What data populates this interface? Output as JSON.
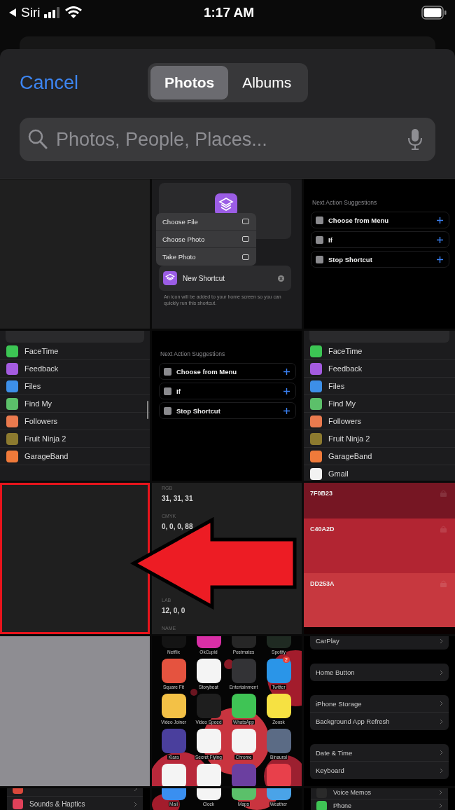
{
  "status_bar": {
    "back_label": "Siri",
    "time": "1:17 AM"
  },
  "header": {
    "cancel": "Cancel",
    "segments": [
      {
        "label": "Photos",
        "selected": true
      },
      {
        "label": "Albums",
        "selected": false
      }
    ],
    "search": {
      "placeholder": "Photos, People, Places..."
    }
  },
  "thumbnails": [
    {
      "kind": "blank",
      "highlighted": false
    },
    {
      "kind": "shortcut_menu",
      "highlighted": false,
      "menu": [
        "Choose File",
        "Choose Photo",
        "Take Photo"
      ],
      "name": "New Shortcut",
      "note": "An icon will be added to your home screen so you can quickly run this shortcut."
    },
    {
      "kind": "suggestions",
      "highlighted": false,
      "heading": "Next Action Suggestions",
      "actions": [
        "Choose from Menu",
        "If",
        "Stop Shortcut"
      ]
    },
    {
      "kind": "app_list",
      "highlighted": false,
      "scrollbar": true,
      "apps": [
        {
          "name": "FaceTime",
          "color": "#3cc654"
        },
        {
          "name": "Feedback",
          "color": "#a45be0"
        },
        {
          "name": "Files",
          "color": "#3d8fe8"
        },
        {
          "name": "Find My",
          "color": "#5cc06a"
        },
        {
          "name": "Followers",
          "color": "#ea7a4e"
        },
        {
          "name": "Fruit Ninja 2",
          "color": "#8c7a2f"
        },
        {
          "name": "GarageBand",
          "color": "#f07a3a"
        }
      ]
    },
    {
      "kind": "suggestions",
      "highlighted": false,
      "heading": "Next Action Suggestions",
      "actions": [
        "Choose from Menu",
        "If",
        "Stop Shortcut"
      ]
    },
    {
      "kind": "app_list",
      "highlighted": false,
      "scrollbar": false,
      "apps": [
        {
          "name": "FaceTime",
          "color": "#3cc654"
        },
        {
          "name": "Feedback",
          "color": "#a45be0"
        },
        {
          "name": "Files",
          "color": "#3d8fe8"
        },
        {
          "name": "Find My",
          "color": "#5cc06a"
        },
        {
          "name": "Followers",
          "color": "#ea7a4e"
        },
        {
          "name": "Fruit Ninja 2",
          "color": "#8c7a2f"
        },
        {
          "name": "GarageBand",
          "color": "#f07a3a"
        },
        {
          "name": "Gmail",
          "color": "#f2f2f2"
        }
      ]
    },
    {
      "kind": "blank",
      "highlighted": true
    },
    {
      "kind": "color_info",
      "highlighted": false,
      "fields": [
        {
          "label": "RGB",
          "value": "31, 31, 31"
        },
        {
          "label": "CMYK",
          "value": "0, 0, 0, 88"
        },
        {
          "label": "LAB",
          "value": "12, 0, 0"
        },
        {
          "label": "NAME"
        }
      ]
    },
    {
      "kind": "palette",
      "highlighted": false,
      "swatches": [
        {
          "hex": "7F0B23",
          "color": "#761623"
        },
        {
          "hex": "C40A2D",
          "color": "#b22532"
        },
        {
          "hex": "DD253A",
          "color": "#c7383f"
        }
      ]
    },
    {
      "kind": "gray",
      "highlighted": false
    },
    {
      "kind": "home_screen",
      "highlighted": false,
      "apps": [
        {
          "name": "Netflix",
          "color": "#141414"
        },
        {
          "name": "OkCupid",
          "color": "#d92fa6"
        },
        {
          "name": "Postmates",
          "color": "#262626"
        },
        {
          "name": "Spotify",
          "color": "#1f2a22"
        },
        {
          "name": "Square Fit",
          "color": "#e5533f"
        },
        {
          "name": "Storybeat",
          "color": "#f4f4f4"
        },
        {
          "name": "Entertainment",
          "color": "#333336"
        },
        {
          "name": "Twitter",
          "color": "#2a95e8"
        },
        {
          "name": "Video Joiner",
          "color": "#f3c146"
        },
        {
          "name": "Video Speed",
          "color": "#1e1e1e"
        },
        {
          "name": "WhatsApp",
          "color": "#3fc455"
        },
        {
          "name": "Zoosk",
          "color": "#f6e142"
        },
        {
          "name": "Klara",
          "color": "#4a3f9d"
        },
        {
          "name": "Secret Flying",
          "color": "#f4f4f4"
        },
        {
          "name": "Chrome",
          "color": "#f4f4f4"
        },
        {
          "name": "Binaural",
          "color": "#5b6b85"
        },
        {
          "color": "#f4f4f4"
        },
        {
          "color": "#f4f4f4"
        },
        {
          "color": "#6b3fa0"
        },
        {
          "color": "#e8404b"
        }
      ],
      "badge": "2"
    },
    {
      "kind": "settings",
      "highlighted": false,
      "groups": [
        [
          "CarPlay"
        ],
        [
          "Home Button"
        ],
        [
          "iPhone Storage",
          "Background App Refresh"
        ],
        [
          "Date & Time",
          "Keyboard"
        ]
      ]
    },
    {
      "kind": "settings_rows",
      "highlighted": false,
      "rows": [
        {
          "color": "#d9483b"
        },
        {
          "label": "Sounds & Haptics",
          "color": "#e0415a"
        }
      ]
    },
    {
      "kind": "dock",
      "highlighted": false,
      "apps": [
        {
          "name": "Mail",
          "color": "#3a8ff0"
        },
        {
          "name": "Clock",
          "color": "#f4f4f4"
        },
        {
          "name": "Maps",
          "color": "#5bc06a"
        },
        {
          "name": "Weather",
          "color": "#4aa3e8"
        }
      ]
    },
    {
      "kind": "settings_rows",
      "highlighted": false,
      "rows": [
        {
          "label": "Voice Memos",
          "color": "#2a2a2a"
        },
        {
          "label": "Phone",
          "color": "#3fc455"
        }
      ]
    }
  ]
}
